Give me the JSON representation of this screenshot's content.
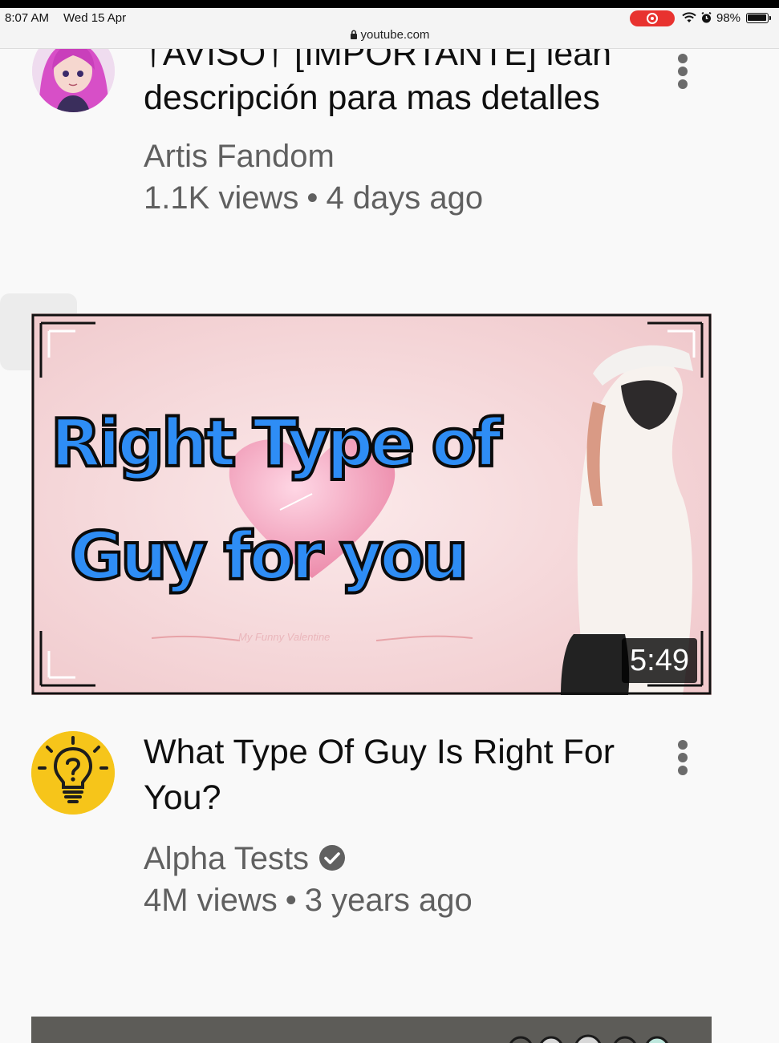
{
  "status_bar": {
    "time": "8:07 AM",
    "date": "Wed 15 Apr",
    "battery": "98%",
    "url": "youtube.com"
  },
  "video1": {
    "title_top": "†AVISO† [IMPORTANTE] lean",
    "title_bottom": "descripción para mas detalles",
    "channel": "Artis Fandom",
    "views": "1.1K views",
    "separator": "•",
    "age": "4 days ago"
  },
  "video2": {
    "thumb_line1": "Right Type of",
    "thumb_line2": "Guy for you",
    "thumb_watermark": "My Funny Valentine",
    "duration": "5:49",
    "title": "What Type Of Guy Is Right For You?",
    "channel": "Alpha Tests",
    "views": "4M views",
    "separator": "•",
    "age": "3 years ago"
  },
  "colors": {
    "recording": "#e8322f",
    "thumb_text": "#2e8df5",
    "avatar_bulb": "#f6c51a",
    "meta_text": "#606060"
  },
  "icons": [
    "lock-icon",
    "wifi-icon",
    "alarm-icon",
    "battery-icon",
    "more-vert-icon",
    "verified-check-icon",
    "lightbulb-question-icon"
  ]
}
